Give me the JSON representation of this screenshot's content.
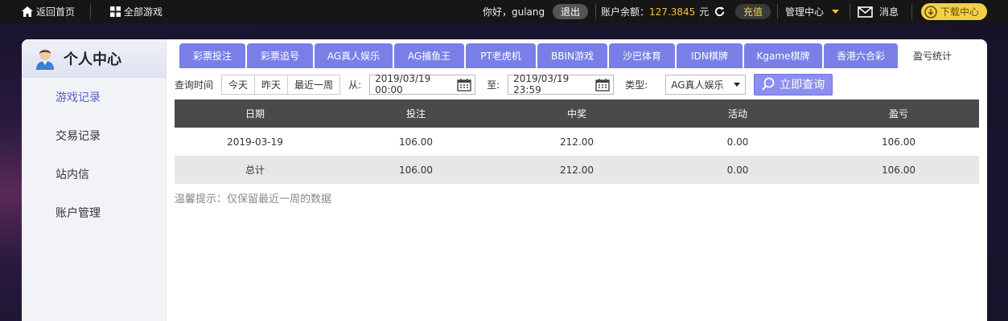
{
  "topbar": {
    "home": "返回首页",
    "all_games": "全部游戏",
    "greeting": "你好，gulang",
    "logout": "退出",
    "balance_label": "账户余额：",
    "balance_value": "127.3845",
    "balance_unit": "元",
    "recharge": "充值",
    "manage": "管理中心",
    "message": "消息",
    "download": "下载中心"
  },
  "sidebar": {
    "title": "个人中心",
    "items": [
      {
        "label": "游戏记录"
      },
      {
        "label": "交易记录"
      },
      {
        "label": "站内信"
      },
      {
        "label": "账户管理"
      }
    ]
  },
  "tabs": [
    {
      "label": "彩票投注"
    },
    {
      "label": "彩票追号"
    },
    {
      "label": "AG真人娱乐"
    },
    {
      "label": "AG捕鱼王"
    },
    {
      "label": "PT老虎机"
    },
    {
      "label": "BBIN游戏"
    },
    {
      "label": "沙巴体育"
    },
    {
      "label": "IDN棋牌"
    },
    {
      "label": "Kgame棋牌"
    },
    {
      "label": "香港六合彩"
    },
    {
      "label": "盈亏统计"
    }
  ],
  "filters": {
    "query_time_label": "查询时间",
    "today": "今天",
    "yesterday": "昨天",
    "last_week": "最近一周",
    "from_label": "从:",
    "from_value": "2019/03/19 00:00",
    "to_label": "至:",
    "to_value": "2019/03/19 23:59",
    "type_label": "类型:",
    "type_value": "AG真人娱乐",
    "query_button": "立即查询"
  },
  "table": {
    "headers": [
      "日期",
      "投注",
      "中奖",
      "活动",
      "盈亏"
    ],
    "rows": [
      [
        "2019-03-19",
        "106.00",
        "212.00",
        "0.00",
        "106.00"
      ],
      [
        "总计",
        "106.00",
        "212.00",
        "0.00",
        "106.00"
      ]
    ]
  },
  "hint": "温馨提示：仅保留最近一周的数据"
}
